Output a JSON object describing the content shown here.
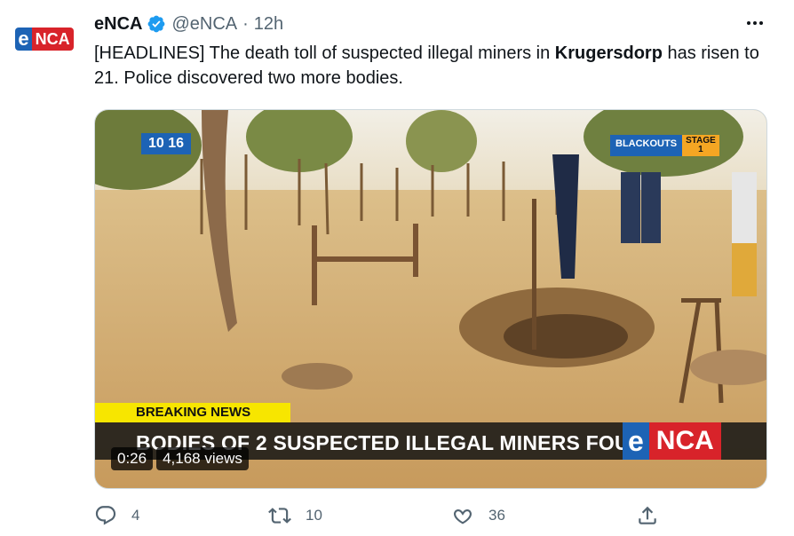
{
  "tweet": {
    "author_name": "eNCA",
    "handle": "@eNCA",
    "separator": "·",
    "time": "12h",
    "text_before": "[HEADLINES] The death toll of suspected illegal miners in ",
    "text_bold": "Krugersdorp",
    "text_after": " has risen to 21. Police discovered two more bodies."
  },
  "avatar": {
    "logo_e": "e",
    "logo_nca": "NCA"
  },
  "video": {
    "clock": "10 16",
    "blackouts_label": "BLACKOUTS",
    "stage_label": "STAGE",
    "stage_value": "1",
    "breaking_label": "BREAKING NEWS",
    "headline": "BODIES OF 2 SUSPECTED ILLEGAL MINERS FOUND",
    "logo_e": "e",
    "logo_nca": "NCA",
    "duration": "0:26",
    "views": "4,168 views"
  },
  "actions": {
    "reply_count": "4",
    "retweet_count": "10",
    "like_count": "36"
  },
  "colors": {
    "brand_blue": "#1d63b5",
    "brand_red": "#d8232a",
    "breaking_yellow": "#f7e600",
    "verified_blue": "#1d9bf0",
    "secondary_text": "#536471"
  },
  "icons": [
    "verified-badge-icon",
    "more-icon",
    "reply-icon",
    "retweet-icon",
    "like-icon",
    "share-icon"
  ]
}
